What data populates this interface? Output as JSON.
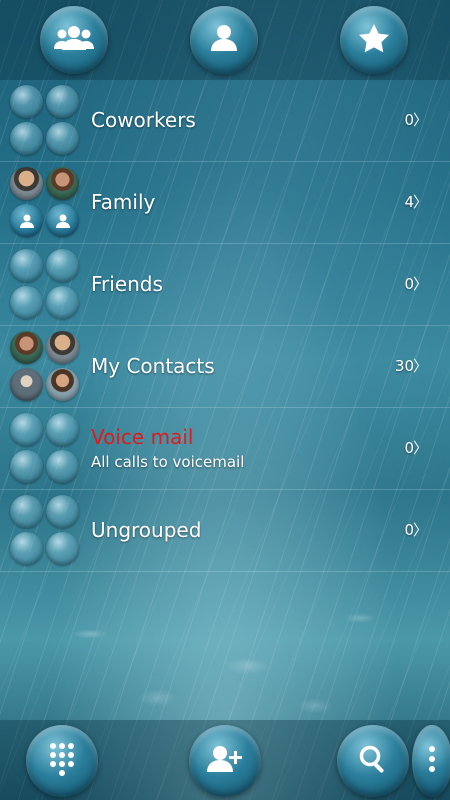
{
  "top_tabs": [
    {
      "name": "groups",
      "icon": "groups-icon"
    },
    {
      "name": "contacts",
      "icon": "person-icon"
    },
    {
      "name": "favorites",
      "icon": "star-icon"
    }
  ],
  "groups": [
    {
      "name": "Coworkers",
      "subtitle": "",
      "count": "0",
      "chevron": "〉"
    },
    {
      "name": "Family",
      "subtitle": "",
      "count": "4",
      "chevron": "〉"
    },
    {
      "name": "Friends",
      "subtitle": "",
      "count": "0",
      "chevron": "〉"
    },
    {
      "name": "My Contacts",
      "subtitle": "",
      "count": "30",
      "chevron": "〉"
    },
    {
      "name": "Voice mail",
      "subtitle": "All calls to voicemail",
      "count": "0",
      "chevron": "〉",
      "name_color": "#e01b1b"
    },
    {
      "name": "Ungrouped",
      "subtitle": "",
      "count": "0",
      "chevron": "〉"
    }
  ],
  "bottom_actions": [
    {
      "name": "dialpad",
      "icon": "dialpad-icon"
    },
    {
      "name": "add-contact",
      "icon": "add-person-icon"
    },
    {
      "name": "search",
      "icon": "search-icon"
    },
    {
      "name": "overflow-menu",
      "icon": "more-vert-icon"
    }
  ]
}
